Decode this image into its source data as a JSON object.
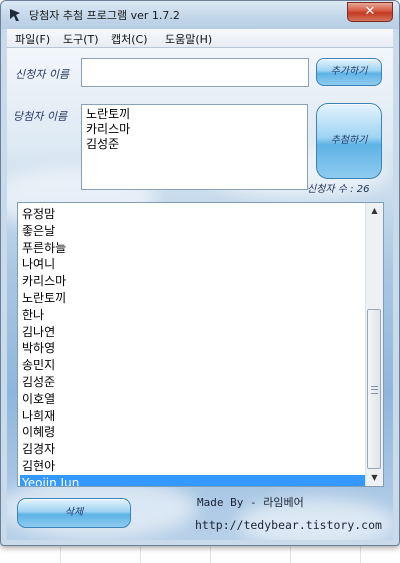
{
  "window": {
    "title": "당첨자 추첨 프로그램 ver 1.7.2",
    "close_label": "✕"
  },
  "menu": [
    {
      "label": "파일(F)"
    },
    {
      "label": "도구(T)"
    },
    {
      "label": "캡처(C)"
    },
    {
      "label": "도움말(H)"
    }
  ],
  "form": {
    "applicant_label": "신청자 이름",
    "applicant_value": "",
    "add_button": "추가하기",
    "winner_label": "당첨자 이름",
    "winners": [
      "노란토끼",
      "카리스마",
      "김성준"
    ],
    "draw_button": "추첨하기",
    "count_label": "신청자 수 :",
    "count_value": "26"
  },
  "list": {
    "items": [
      "유정맘",
      "좋은날",
      "푸른하늘",
      "나여니",
      "카리스마",
      "노란토끼",
      "한나",
      "김나연",
      "박하영",
      "송민지",
      "김성준",
      "이호열",
      "나희재",
      "이혜령",
      "김경자",
      "김현아",
      "Yeojin Jun"
    ],
    "selected_index": 16
  },
  "footer": {
    "delete_button": "삭제",
    "made_by": "Made By - 라임베어",
    "url": "http://tedybear.tistory.com"
  },
  "colors": {
    "selection": "#3399ff",
    "button": "#5db3e6",
    "close": "#c03a22"
  }
}
